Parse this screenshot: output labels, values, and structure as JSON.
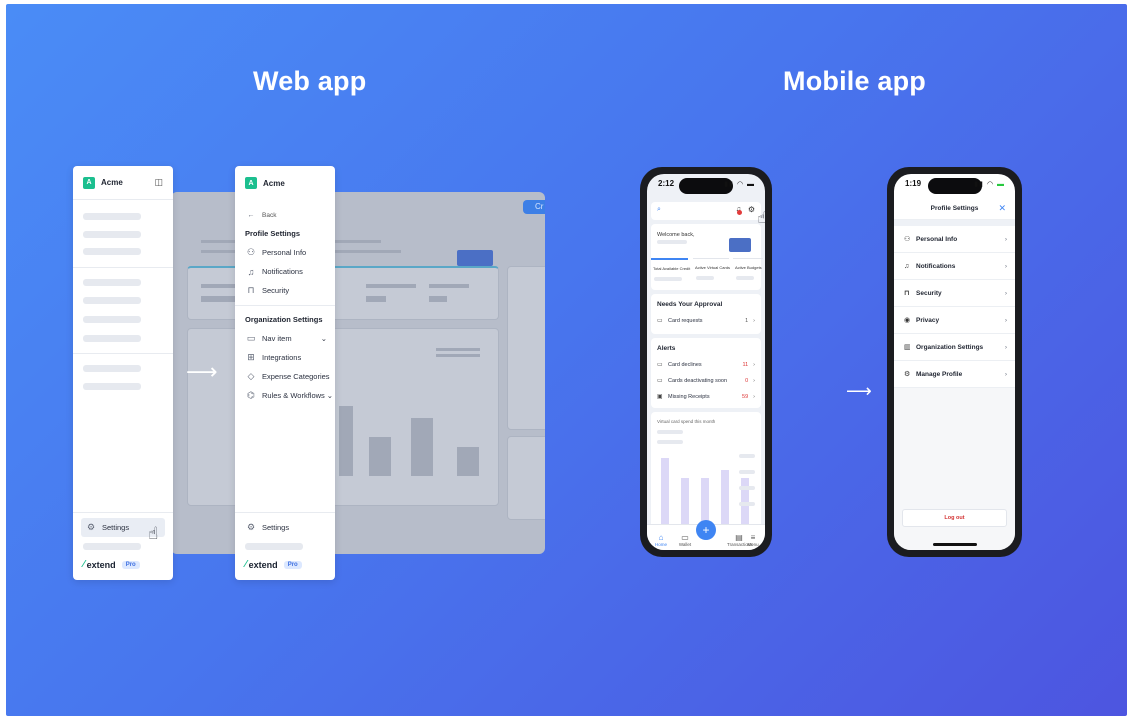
{
  "titles": {
    "web": "Web app",
    "mobile": "Mobile app"
  },
  "org": {
    "initial": "A",
    "name": "Acme"
  },
  "web": {
    "top_button": "Cr",
    "settings_label": "Settings",
    "back_label": "Back",
    "profile_heading": "Profile Settings",
    "profile_items": [
      {
        "icon": "person-icon",
        "label": "Personal Info"
      },
      {
        "icon": "bell-icon",
        "label": "Notifications"
      },
      {
        "icon": "lock-icon",
        "label": "Security"
      }
    ],
    "org_heading": "Organization Settings",
    "org_items": [
      {
        "icon": "card-icon",
        "label": "Nav item",
        "chev": "⌄"
      },
      {
        "icon": "integrations-icon",
        "label": "Integrations",
        "chev": ""
      },
      {
        "icon": "tag-icon",
        "label": "Expense Categories",
        "chev": ""
      },
      {
        "icon": "rules-icon",
        "label": "Rules & Workflows",
        "chev": "⌄"
      }
    ],
    "brand": "extend",
    "plan": "Pro"
  },
  "mobile_home": {
    "time": "2:12",
    "welcome": "Welcome back,",
    "tabs": [
      "Total Available Credit",
      "Active Virtual Cards",
      "Active Budgets"
    ],
    "approval_title": "Needs Your Approval",
    "approval_row": {
      "label": "Card requests",
      "value": "1"
    },
    "alerts_title": "Alerts",
    "alerts": [
      {
        "label": "Card declines",
        "value": "11"
      },
      {
        "label": "Cards deactivating soon",
        "value": "0"
      },
      {
        "label": "Missing Receipts",
        "value": "59"
      }
    ],
    "chart_title": "Virtual card spend this month",
    "nav": [
      "Home",
      "Wallet",
      "Transactions",
      "Menu"
    ]
  },
  "mobile_settings": {
    "time": "1:19",
    "title": "Profile Settings",
    "items": [
      {
        "icon": "person-icon",
        "label": "Personal Info"
      },
      {
        "icon": "bell-icon",
        "label": "Notifications"
      },
      {
        "icon": "lock-icon",
        "label": "Security"
      },
      {
        "icon": "eye-icon",
        "label": "Privacy"
      },
      {
        "icon": "building-icon",
        "label": "Organization Settings"
      },
      {
        "icon": "gear-icon",
        "label": "Manage Profile"
      }
    ],
    "logout": "Log out"
  },
  "colors": {
    "accent": "#3f85f3",
    "brand_green": "#1cbf8f",
    "alert_red": "#d33333"
  }
}
